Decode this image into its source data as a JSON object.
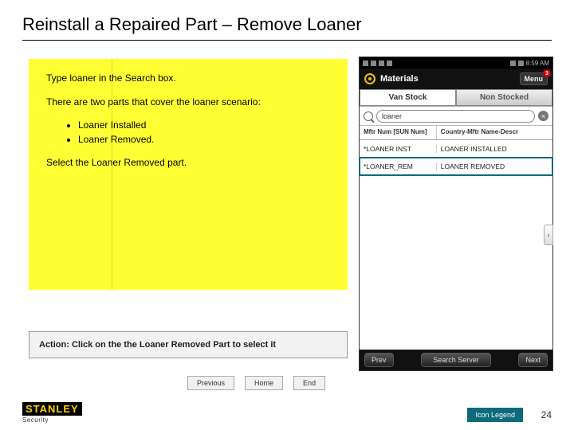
{
  "title": "Reinstall a Repaired Part – Remove Loaner",
  "note": {
    "line1": "Type loaner in the Search box.",
    "line2": "There are two parts that cover the loaner scenario:",
    "bullet1": "Loaner Installed",
    "bullet2": "Loaner Removed.",
    "line3": "Select the Loaner Removed part."
  },
  "action": "Action:  Click on the the Loaner Removed Part to select it",
  "phone": {
    "statusbar": {
      "time": "8:59 AM"
    },
    "appbar": {
      "title": "Materials",
      "menu": "Menu",
      "badge": "3"
    },
    "tabs": {
      "active": "Van Stock",
      "inactive": "Non Stocked"
    },
    "search": {
      "value": "loaner"
    },
    "columns": {
      "a": "Mftr Num  [SUN Num]",
      "b": "Country-Mftr Name-Descr"
    },
    "rows": [
      {
        "a": "*LOANER INST",
        "b": "LOANER INSTALLED"
      },
      {
        "a": "*LOANER_REM",
        "b": "LOANER REMOVED"
      }
    ],
    "bottombar": {
      "prev": "Prev",
      "search": "Search Server",
      "next": "Next"
    }
  },
  "nav": {
    "prev": "Previous",
    "home": "Home",
    "end": "End"
  },
  "footer": {
    "brand": "STANLEY",
    "brand_sub": "Security",
    "legend": "Icon Legend",
    "page": "24"
  }
}
